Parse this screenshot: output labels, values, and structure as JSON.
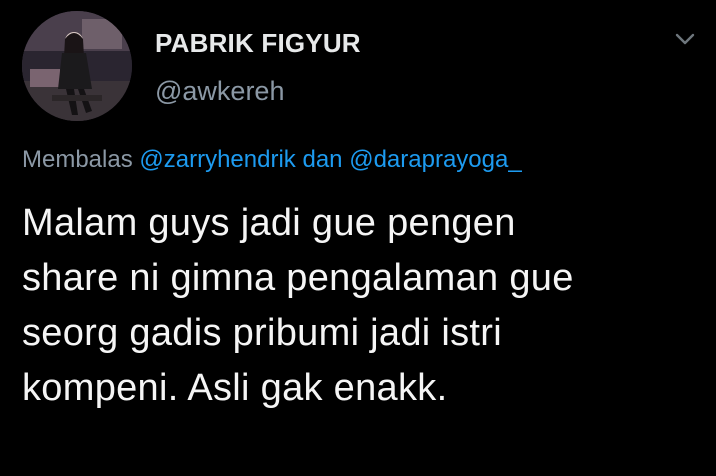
{
  "author": {
    "display_name": "PABRIK FIGYUR",
    "handle": "@awkereh",
    "avatar_icon": "profile-photo"
  },
  "reply": {
    "prefix": "Membalas",
    "mentions": [
      "@zarryhendrik",
      "@daraprayoga_"
    ],
    "connector": "dan"
  },
  "tweet": {
    "lines": [
      "Malam guys jadi gue pengen",
      "share ni gimna pengalaman gue",
      "seorg gadis pribumi jadi istri",
      "kompeni. Asli gak enakk."
    ]
  },
  "icons": {
    "menu": "chevron-down-icon"
  },
  "colors": {
    "background": "#000000",
    "text": "#e7e9ea",
    "secondary": "#8b98a5",
    "link": "#1d9bf0"
  }
}
